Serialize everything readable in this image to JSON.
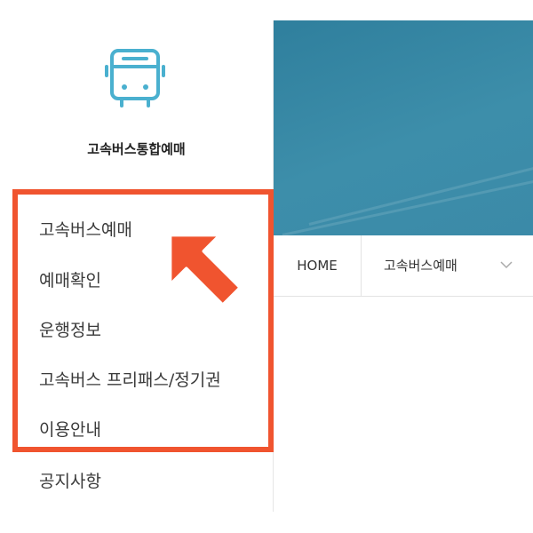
{
  "logo": {
    "icon": "bus-icon",
    "title": "고속버스통합예매",
    "color": "#4ab0cf"
  },
  "sidebar": {
    "items": [
      {
        "label": "고속버스예매"
      },
      {
        "label": "예매확인"
      },
      {
        "label": "운행정보"
      },
      {
        "label": "고속버스 프리패스/정기권"
      },
      {
        "label": "이용안내"
      },
      {
        "label": "공지사항"
      }
    ]
  },
  "navbar": {
    "home": "HOME",
    "current": "고속버스예매",
    "dropdown_icon": "chevron-down-icon"
  },
  "annotation": {
    "box_color": "#f0542f",
    "arrow_color": "#f0542f",
    "arrow_icon": "arrow-up-left-icon"
  },
  "banner": {
    "color": "#3b8aa8"
  }
}
